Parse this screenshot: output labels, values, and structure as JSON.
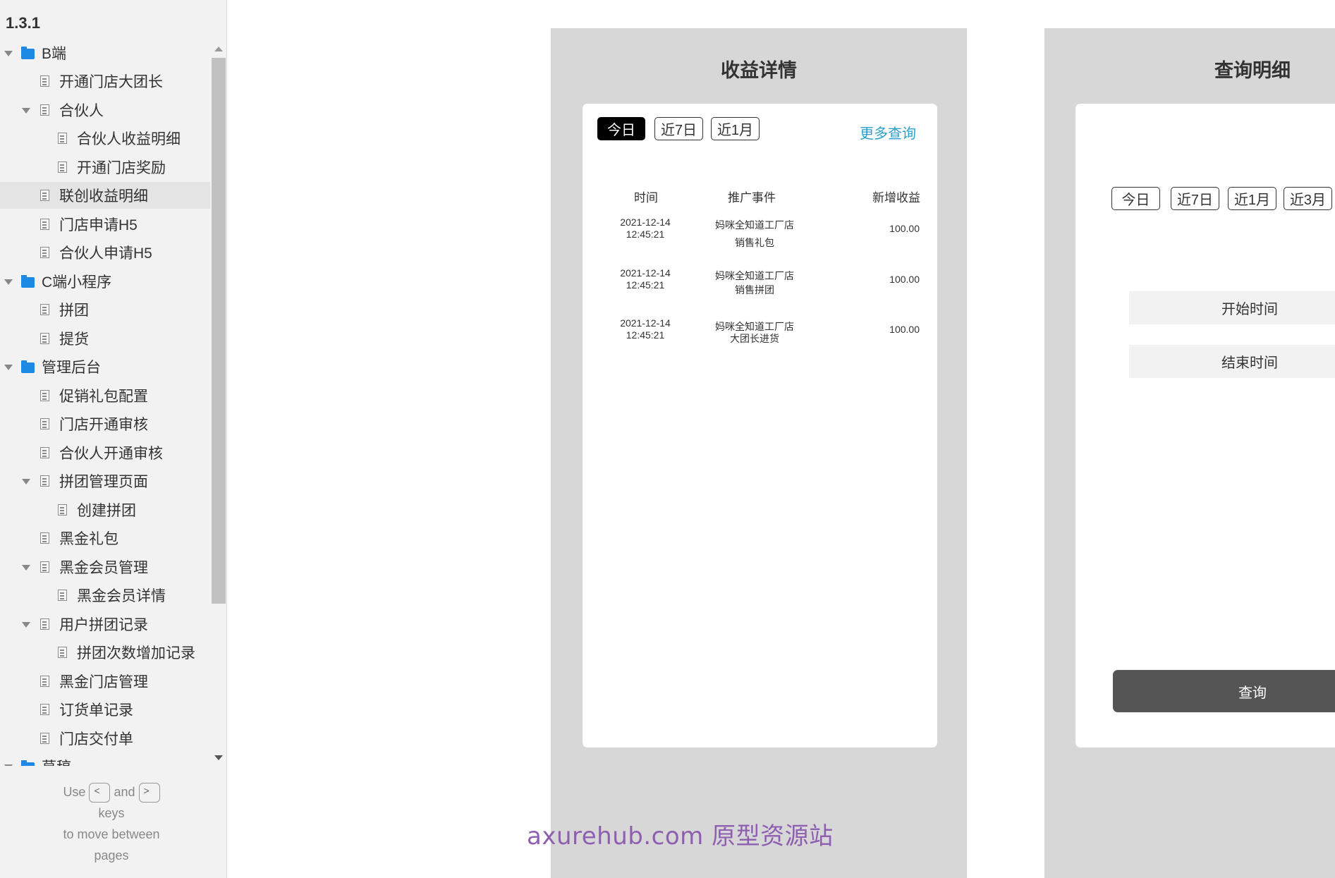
{
  "sidebar": {
    "version": "1.3.1",
    "items": [
      {
        "label": "B端",
        "type": "folder"
      },
      {
        "label": "开通门店大团长",
        "type": "page"
      },
      {
        "label": "合伙人",
        "type": "page"
      },
      {
        "label": "合伙人收益明细",
        "type": "page"
      },
      {
        "label": "开通门店奖励",
        "type": "page"
      },
      {
        "label": "联创收益明细",
        "type": "page",
        "selected": true
      },
      {
        "label": "门店申请H5",
        "type": "page"
      },
      {
        "label": "合伙人申请H5",
        "type": "page"
      },
      {
        "label": "C端小程序",
        "type": "folder"
      },
      {
        "label": "拼团",
        "type": "page"
      },
      {
        "label": "提货",
        "type": "page"
      },
      {
        "label": "管理后台",
        "type": "folder"
      },
      {
        "label": "促销礼包配置",
        "type": "page"
      },
      {
        "label": "门店开通审核",
        "type": "page"
      },
      {
        "label": "合伙人开通审核",
        "type": "page"
      },
      {
        "label": "拼团管理页面",
        "type": "page"
      },
      {
        "label": "创建拼团",
        "type": "page"
      },
      {
        "label": "黑金礼包",
        "type": "page"
      },
      {
        "label": "黑金会员管理",
        "type": "page"
      },
      {
        "label": "黑金会员详情",
        "type": "page"
      },
      {
        "label": "用户拼团记录",
        "type": "page"
      },
      {
        "label": "拼团次数增加记录",
        "type": "page"
      },
      {
        "label": "黑金门店管理",
        "type": "page"
      },
      {
        "label": "订货单记录",
        "type": "page"
      },
      {
        "label": "门店交付单",
        "type": "page"
      },
      {
        "label": "草稿",
        "type": "folder"
      }
    ],
    "hint": {
      "use": "Use",
      "and": "and",
      "keys": "keys",
      "line2": "to move between",
      "line3": "pages",
      "key_prev": "<",
      "key_next": ">"
    }
  },
  "panel1": {
    "title": "收益详情",
    "tabs": [
      "今日",
      "近7日",
      "近1月"
    ],
    "more_link": "更多查询",
    "headers": [
      "时间",
      "推广事件",
      "新增收益"
    ],
    "rows": [
      {
        "date": "2021-12-14",
        "time": "12:45:21",
        "event1": "妈咪全知道工厂店",
        "event2": "销售礼包",
        "amount": "100.00"
      },
      {
        "date": "2021-12-14",
        "time": "12:45:21",
        "event1": "妈咪全知道工厂店",
        "event2": "销售拼团",
        "amount": "100.00"
      },
      {
        "date": "2021-12-14",
        "time": "12:45:21",
        "event1": "妈咪全知道工厂店",
        "event2": "大团长进货",
        "amount": "100.00"
      }
    ]
  },
  "panel2": {
    "title": "查询明细",
    "tabs": [
      "今日",
      "近7日",
      "近1月",
      "近3月"
    ],
    "start_label": "开始时间",
    "end_label": "结束时间",
    "query_button": "查询"
  },
  "watermark": "axurehub.com 原型资源站",
  "colors": {
    "accent_link": "#2a9fc9",
    "folder": "#1e88e5",
    "active_tab": "#000000",
    "panel_bg": "#d7d7d7",
    "watermark": "#8e5fb0"
  }
}
